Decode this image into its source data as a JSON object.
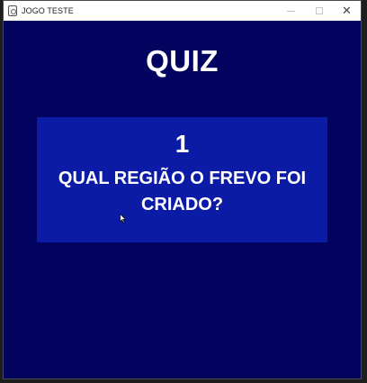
{
  "window": {
    "title": "JOGO TESTE",
    "controls": {
      "minimize": "minimize-icon",
      "maximize": "maximize-icon",
      "close": "✕"
    }
  },
  "quiz": {
    "title": "QUIZ",
    "question_number": "1",
    "question_text": "QUAL REGIÃO O FREVO FOI CRIADO?"
  },
  "colors": {
    "background": "#02035e",
    "panel": "#0b1ba6",
    "text": "#ffffff"
  }
}
